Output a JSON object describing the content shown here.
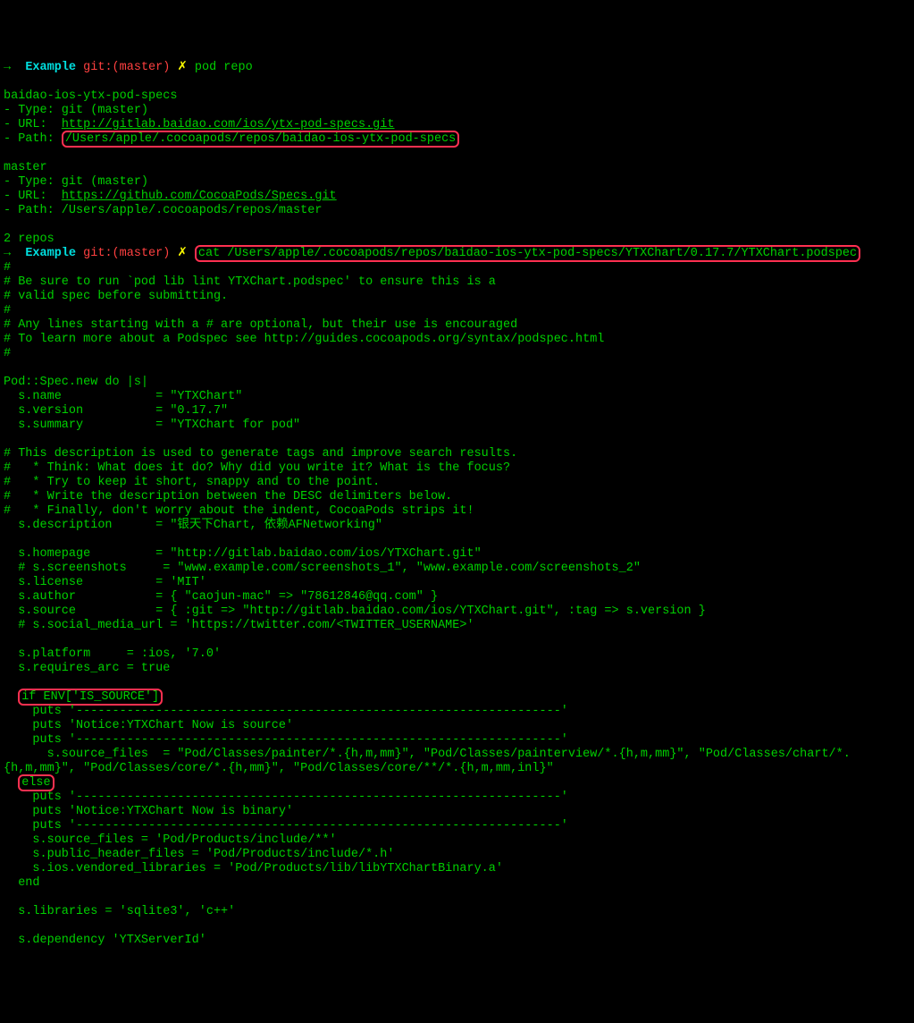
{
  "prompt1": {
    "arrow": "→",
    "dir": "Example",
    "git": "git:(",
    "branch": "master",
    "close": ")",
    "mark": "✗",
    "cmd": "pod repo"
  },
  "repo1": {
    "name": "baidao-ios-ytx-pod-specs",
    "type": "- Type: git (master)",
    "url_label": "- URL:  ",
    "url": "http://gitlab.baidao.com/ios/ytx-pod-specs.git",
    "path_label": "- Path: ",
    "path": "/Users/apple/.cocoapods/repos/baidao-ios-ytx-pod-specs"
  },
  "repo2": {
    "name": "master",
    "type": "- Type: git (master)",
    "url_label": "- URL:  ",
    "url": "https://github.com/CocoaPods/Specs.git",
    "path_label": "- Path: /Users/apple/.cocoapods/repos/master"
  },
  "summary": "2 repos",
  "prompt2": {
    "arrow": "→",
    "dir": "Example",
    "git": "git:(",
    "branch": "master",
    "close": ")",
    "mark": "✗",
    "cmd": "cat /Users/apple/.cocoapods/repos/baidao-ios-ytx-pod-specs/YTXChart/0.17.7/YTXChart.podspec"
  },
  "spec": {
    "c1": "#",
    "c2": "# Be sure to run `pod lib lint YTXChart.podspec' to ensure this is a",
    "c3": "# valid spec before submitting.",
    "c4": "#",
    "c5": "# Any lines starting with a # are optional, but their use is encouraged",
    "c6": "# To learn more about a Podspec see http://guides.cocoapods.org/syntax/podspec.html",
    "c7": "#",
    "open": "Pod::Spec.new do |s|",
    "name": "  s.name             = \"YTXChart\"",
    "version": "  s.version          = \"0.17.7\"",
    "summary": "  s.summary          = \"YTXChart for pod\"",
    "d1": "# This description is used to generate tags and improve search results.",
    "d2": "#   * Think: What does it do? Why did you write it? What is the focus?",
    "d3": "#   * Try to keep it short, snappy and to the point.",
    "d4": "#   * Write the description between the DESC delimiters below.",
    "d5": "#   * Finally, don't worry about the indent, CocoaPods strips it!",
    "desc": "  s.description      = \"银天下Chart, 依赖AFNetworking\"",
    "home": "  s.homepage         = \"http://gitlab.baidao.com/ios/YTXChart.git\"",
    "screen": "  # s.screenshots     = \"www.example.com/screenshots_1\", \"www.example.com/screenshots_2\"",
    "license": "  s.license          = 'MIT'",
    "author": "  s.author           = { \"caojun-mac\" => \"78612846@qq.com\" }",
    "source": "  s.source           = { :git => \"http://gitlab.baidao.com/ios/YTXChart.git\", :tag => s.version }",
    "social": "  # s.social_media_url = 'https://twitter.com/<TWITTER_USERNAME>'",
    "platform": "  s.platform     = :ios, '7.0'",
    "arc": "  s.requires_arc = true",
    "if": "if ENV['IS_SOURCE']",
    "puts1": "    puts '-------------------------------------------------------------------'",
    "puts2": "    puts 'Notice:YTXChart Now is source'",
    "puts3": "    puts '-------------------------------------------------------------------'",
    "srcfiles": "      s.source_files  = \"Pod/Classes/painter/*.{h,m,mm}\", \"Pod/Classes/painterview/*.{h,m,mm}\", \"Pod/Classes/chart/*.{h,m,mm}\", \"Pod/Classes/core/*.{h,mm}\", \"Pod/Classes/core/**/*.{h,m,mm,inl}\"",
    "else": "else",
    "puts4": "    puts '-------------------------------------------------------------------'",
    "puts5": "    puts 'Notice:YTXChart Now is binary'",
    "puts6": "    puts '-------------------------------------------------------------------'",
    "srcfiles2": "    s.source_files = 'Pod/Products/include/**'",
    "pubheaders": "    s.public_header_files = 'Pod/Products/include/*.h'",
    "vendored": "    s.ios.vendored_libraries = 'Pod/Products/lib/libYTXChartBinary.a'",
    "end": "  end",
    "libs": "  s.libraries = 'sqlite3', 'c++'",
    "dep": "  s.dependency 'YTXServerId'"
  }
}
